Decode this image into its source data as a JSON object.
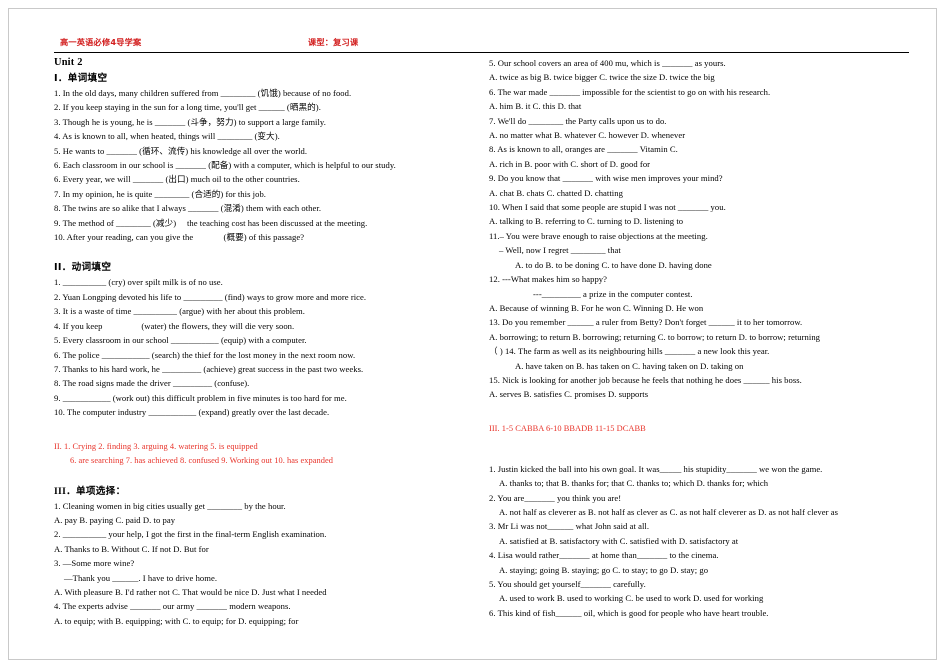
{
  "header": {
    "left": "高一英语必修4导学案",
    "right": "课型：复习课"
  },
  "unit_title": "Unit 2",
  "section1": {
    "heading": "I．单词填空",
    "items": [
      "1. In the old days, many children suffered from ________ (饥饿) because of no food.",
      "2. If you keep staying in the sun for a long time, you'll get ______ (晒黑的).",
      "3. Though he is young, he is _______ (斗争，努力) to support a large family.",
      "4. As is known to all, when heated, things will ________ (变大).",
      "5. He wants to _______ (循环、流传) his knowledge all over the world.",
      "6. Each classroom in our school is _______ (配备) with a computer, which is helpful to our study.",
      "6. Every year, we will _______ (出口) much oil to the other countries.",
      "7. In my opinion, he is quite ________ (合适的) for this job.",
      "8. The twins are so alike that I always _______ (混淆) them with each other.",
      "9. The method of ________ (减少)　 the teaching cost has been discussed at the meeting.",
      "10. After your reading, can you give the 　　　 (概要) of this passage?"
    ]
  },
  "section2": {
    "heading": "II．动词填空",
    "items": [
      "1. __________ (cry) over spilt milk is of no use.",
      "2. Yuan Longping devoted his life to _________ (find) ways to grow more and more rice.",
      "3. It is a waste of time __________ (argue) with her about this problem.",
      "4. If you keep 　　　　 (water) the flowers, they will die very soon.",
      "5. Every classroom in our school ___________ (equip) with a computer.",
      "6. The police ___________ (search) the thief for the lost money in the next room now.",
      "7. Thanks to his hard work, he _________ (achieve) great success in the past two weeks.",
      "8. The road signs made the driver _________ (confuse).",
      "9. ___________ (work out) this difficult problem in five minutes is too hard for me.",
      "10. The computer industry ___________ (expand) greatly over the last decade."
    ],
    "answer_line1": "II. 1. Crying      2. finding     3. arguing      4. watering    5. is equipped",
    "answer_line2": "6. are searching      7. has achieved   8. confused  9. Working out   10. has expanded"
  },
  "section3": {
    "heading": "III．单项选择：",
    "left_items": [
      {
        "q": "1. Cleaning women in big cities usually get ________ by the hour.",
        "opts": "A. pay        B. paying        C. paid       D. to pay",
        "indent": 0
      },
      {
        "q": "2. __________ your help, I got the first in the final-term English examination.",
        "opts": "A. Thanks to        B. Without                C. If not             D. But for",
        "indent": 0
      },
      {
        "q": "3. —Some more wine?",
        "opts": "",
        "indent": 0
      },
      {
        "q": "—Thank you ______. I have to drive home.",
        "opts": "",
        "indent": 1
      },
      {
        "q": "",
        "opts": "A. With pleasure      B. I'd rather not   C. That would be nice   D. Just what I needed",
        "indent": 0
      },
      {
        "q": "4. The experts advise _______ our army _______ modern weapons.",
        "opts": "A. to equip; with        B. equipping; with      C. to equip; for      D. equipping; for",
        "indent": 0
      }
    ],
    "right_items": [
      {
        "q": "5. Our school covers an area of 400 mu, which is _______ as yours.",
        "opts": "A. twice as big             B. twice bigger          C. twice the size           D. twice the big",
        "indent": 0
      },
      {
        "q": "6. The war made _______ impossible for the scientist to go on with his research.",
        "opts": "A. him                 B. it        C. this          D. that",
        "indent": 0
      },
      {
        "q": "7. We'll do ________ the Party calls upon us to do.",
        "opts": "A. no matter what        B. whatever         C. however       D. whenever",
        "indent": 0
      },
      {
        "q": "8. As is known to all, oranges are _______ Vitamin C.",
        "opts": "A. rich in           B. poor with          C. short of        D. good for",
        "indent": 0
      },
      {
        "q": "9. Do you know that _______ with wise men improves your mind?",
        "opts": "A. chat                  B. chats           C. chatted            D. chatting",
        "indent": 0
      },
      {
        "q": "10. When I said that some people are stupid I was not _______ you.",
        "opts": "A. talking to          B. referring to         C. turning to        D. listening to",
        "indent": 0
      },
      {
        "q": "11.– You were brave enough to raise objections at the meeting.",
        "opts": "",
        "indent": 0
      },
      {
        "q": "– Well, now I regret ________ that",
        "opts": "",
        "indent": 1
      },
      {
        "q": "",
        "opts": "A. to do          B. to be doning           C. to have done         D. having done",
        "indent": 2
      },
      {
        "q": "12. ---What makes him so happy?",
        "opts": "",
        "indent": 0
      },
      {
        "q": "---_________ a prize in the computer contest.",
        "opts": "",
        "indent": 3
      },
      {
        "q": "",
        "opts": "A. Because of winning     B. For he won     C. Winning      D. He won",
        "indent": 0
      },
      {
        "q": "13. Do you remember ______ a ruler from Betty? Don't forget ______ it to her tomorrow.",
        "opts": "A. borrowing; to return      B. borrowing; returning    C. to borrow; to return     D. to borrow; returning",
        "indent": 0
      },
      {
        "q": "（   ) 14. The farm as well as its neighbouring hills  _______ a new look this year.",
        "opts": "A. have taken on         B. has taken on    C. having taken on   D. taking on",
        "indent": 0
      },
      {
        "q": "15. Nick is looking for another job because he feels that nothing he does ______ his boss.",
        "opts": "A. serves       B. satisfies      C. promises       D. supports",
        "indent": 0
      }
    ],
    "answer_line": "III. 1-5 CABBA      6-10 BBADB        11-15 DCABB"
  },
  "section4": {
    "items": [
      {
        "q": "1. Justin kicked the ball into his own goal. It was_____ his stupidity_______ we won the game.",
        "opts": "A. thanks to; that     B. thanks for; that   C. thanks to; which   D. thanks for; which"
      },
      {
        "q": "2. You are_______ you think you are!",
        "opts": "A. not half as cleverer as   B. not half as clever as   C. as not half cleverer as D. as not half clever as"
      },
      {
        "q": "3. Mr Li was not______ what John said at all.",
        "opts": "A. satisfied at     B. satisfactory with    C. satisfied with    D. satisfactory at"
      },
      {
        "q": "4. Lisa would rather_______ at home than_______ to the cinema.",
        "opts": "A. staying; going   B. staying; go   C. to stay; to go   D. stay; go"
      },
      {
        "q": "5. You should get yourself_______ carefully.",
        "opts": "A. used to work   B. used to working   C. be used to work   D. used for working"
      },
      {
        "q": "6. This kind of fish______ oil, which is good for people who have heart trouble.",
        "opts": ""
      }
    ]
  }
}
